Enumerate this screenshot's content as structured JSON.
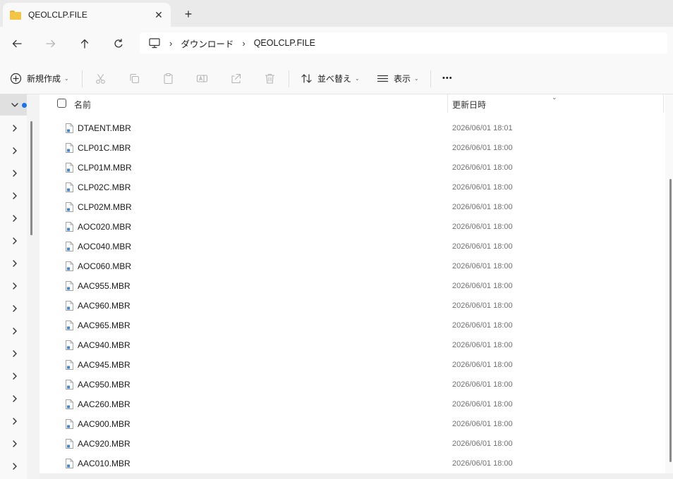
{
  "tab": {
    "title": "QEOLCLP.FILE",
    "close_glyph": "✕",
    "new_glyph": "+"
  },
  "address": {
    "root_icon": "computer-icon",
    "crumbs": [
      "ダウンロード",
      "QEOLCLP.FILE"
    ],
    "separator": "›"
  },
  "toolbar": {
    "new_label": "新規作成",
    "sort_label": "並べ替え",
    "view_label": "表示",
    "more_label": "•••",
    "caret": "⌄"
  },
  "columns": {
    "name": "名前",
    "date": "更新日時",
    "sort_glyph": "⌄"
  },
  "files": [
    {
      "name": "DTAENT.MBR",
      "date": "2026/06/01 18:01"
    },
    {
      "name": "CLP01C.MBR",
      "date": "2026/06/01 18:00"
    },
    {
      "name": "CLP01M.MBR",
      "date": "2026/06/01 18:00"
    },
    {
      "name": "CLP02C.MBR",
      "date": "2026/06/01 18:00"
    },
    {
      "name": "CLP02M.MBR",
      "date": "2026/06/01 18:00"
    },
    {
      "name": "AOC020.MBR",
      "date": "2026/06/01 18:00"
    },
    {
      "name": "AOC040.MBR",
      "date": "2026/06/01 18:00"
    },
    {
      "name": "AOC060.MBR",
      "date": "2026/06/01 18:00"
    },
    {
      "name": "AAC955.MBR",
      "date": "2026/06/01 18:00"
    },
    {
      "name": "AAC960.MBR",
      "date": "2026/06/01 18:00"
    },
    {
      "name": "AAC965.MBR",
      "date": "2026/06/01 18:00"
    },
    {
      "name": "AAC940.MBR",
      "date": "2026/06/01 18:00"
    },
    {
      "name": "AAC945.MBR",
      "date": "2026/06/01 18:00"
    },
    {
      "name": "AAC950.MBR",
      "date": "2026/06/01 18:00"
    },
    {
      "name": "AAC260.MBR",
      "date": "2026/06/01 18:00"
    },
    {
      "name": "AAC900.MBR",
      "date": "2026/06/01 18:00"
    },
    {
      "name": "AAC920.MBR",
      "date": "2026/06/01 18:00"
    },
    {
      "name": "AAC010.MBR",
      "date": "2026/06/01 18:00"
    }
  ],
  "colors": {
    "accent": "#1a73e8",
    "folder": "#f4c542"
  }
}
